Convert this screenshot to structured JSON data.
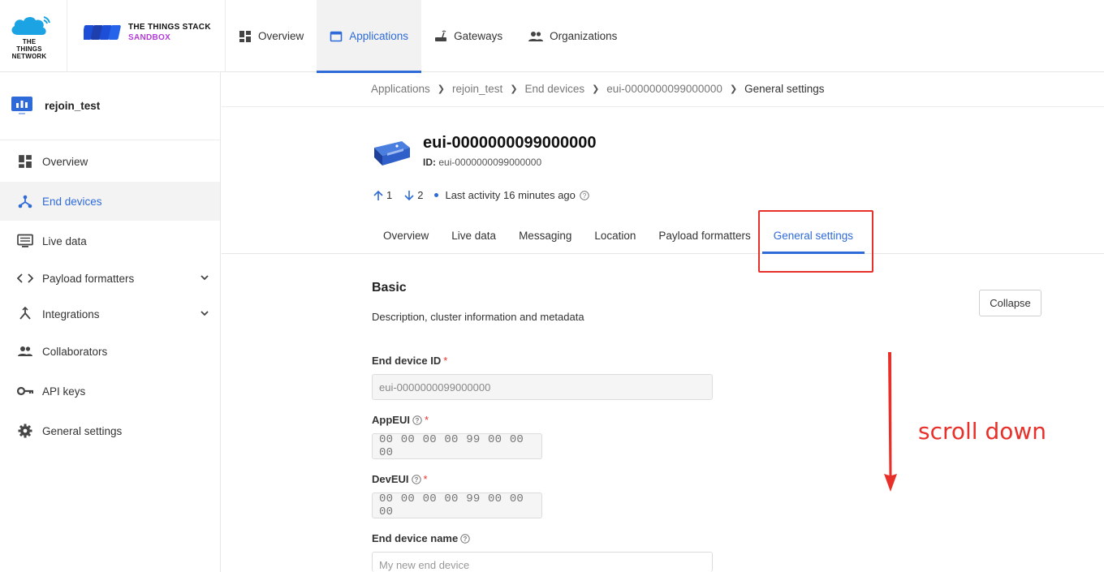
{
  "brand": {
    "ttn_logo_text": "THE THINGS NETWORK",
    "stack_line1": "THE THINGS STACK",
    "stack_line2": "SANDBOX"
  },
  "topnav": [
    {
      "label": "Overview",
      "icon": "dashboard-icon",
      "active": false
    },
    {
      "label": "Applications",
      "icon": "window-icon",
      "active": true
    },
    {
      "label": "Gateways",
      "icon": "router-icon",
      "active": false
    },
    {
      "label": "Organizations",
      "icon": "people-icon",
      "active": false
    }
  ],
  "sidebar": {
    "app_name": "rejoin_test",
    "items": [
      {
        "label": "Overview",
        "icon": "dashboard-icon"
      },
      {
        "label": "End devices",
        "icon": "device-hub-icon"
      },
      {
        "label": "Live data",
        "icon": "monitor-icon"
      },
      {
        "label": "Payload formatters",
        "icon": "code-icon"
      },
      {
        "label": "Integrations",
        "icon": "merge-icon"
      },
      {
        "label": "Collaborators",
        "icon": "people-icon"
      },
      {
        "label": "API keys",
        "icon": "key-icon"
      },
      {
        "label": "General settings",
        "icon": "gear-icon"
      }
    ]
  },
  "breadcrumb": [
    "Applications",
    "rejoin_test",
    "End devices",
    "eui-0000000099000000",
    "General settings"
  ],
  "device": {
    "title": "eui-0000000099000000",
    "id_label": "ID:",
    "id_value": "eui-0000000099000000",
    "uplinks": "1",
    "downlinks": "2",
    "last_activity": "Last activity 16 minutes ago"
  },
  "tabs": [
    "Overview",
    "Live data",
    "Messaging",
    "Location",
    "Payload formatters",
    "General settings"
  ],
  "section": {
    "title": "Basic",
    "description": "Description, cluster information and metadata",
    "collapse_label": "Collapse"
  },
  "fields": {
    "end_device_id": {
      "label": "End device ID",
      "required": "*",
      "value": "eui-0000000099000000"
    },
    "app_eui": {
      "label": "AppEUI",
      "required": "*",
      "value": "00 00 00 00 99 00 00 00"
    },
    "dev_eui": {
      "label": "DevEUI",
      "required": "*",
      "value": "00 00 00 00 99 00 00 00"
    },
    "end_device_name": {
      "label": "End device name",
      "placeholder": "My new end device"
    }
  },
  "annotation": {
    "text": "scroll down"
  },
  "colors": {
    "accent": "#2f6bd8",
    "annotation": "#e8302a",
    "brand_purple": "#b33bd7"
  }
}
